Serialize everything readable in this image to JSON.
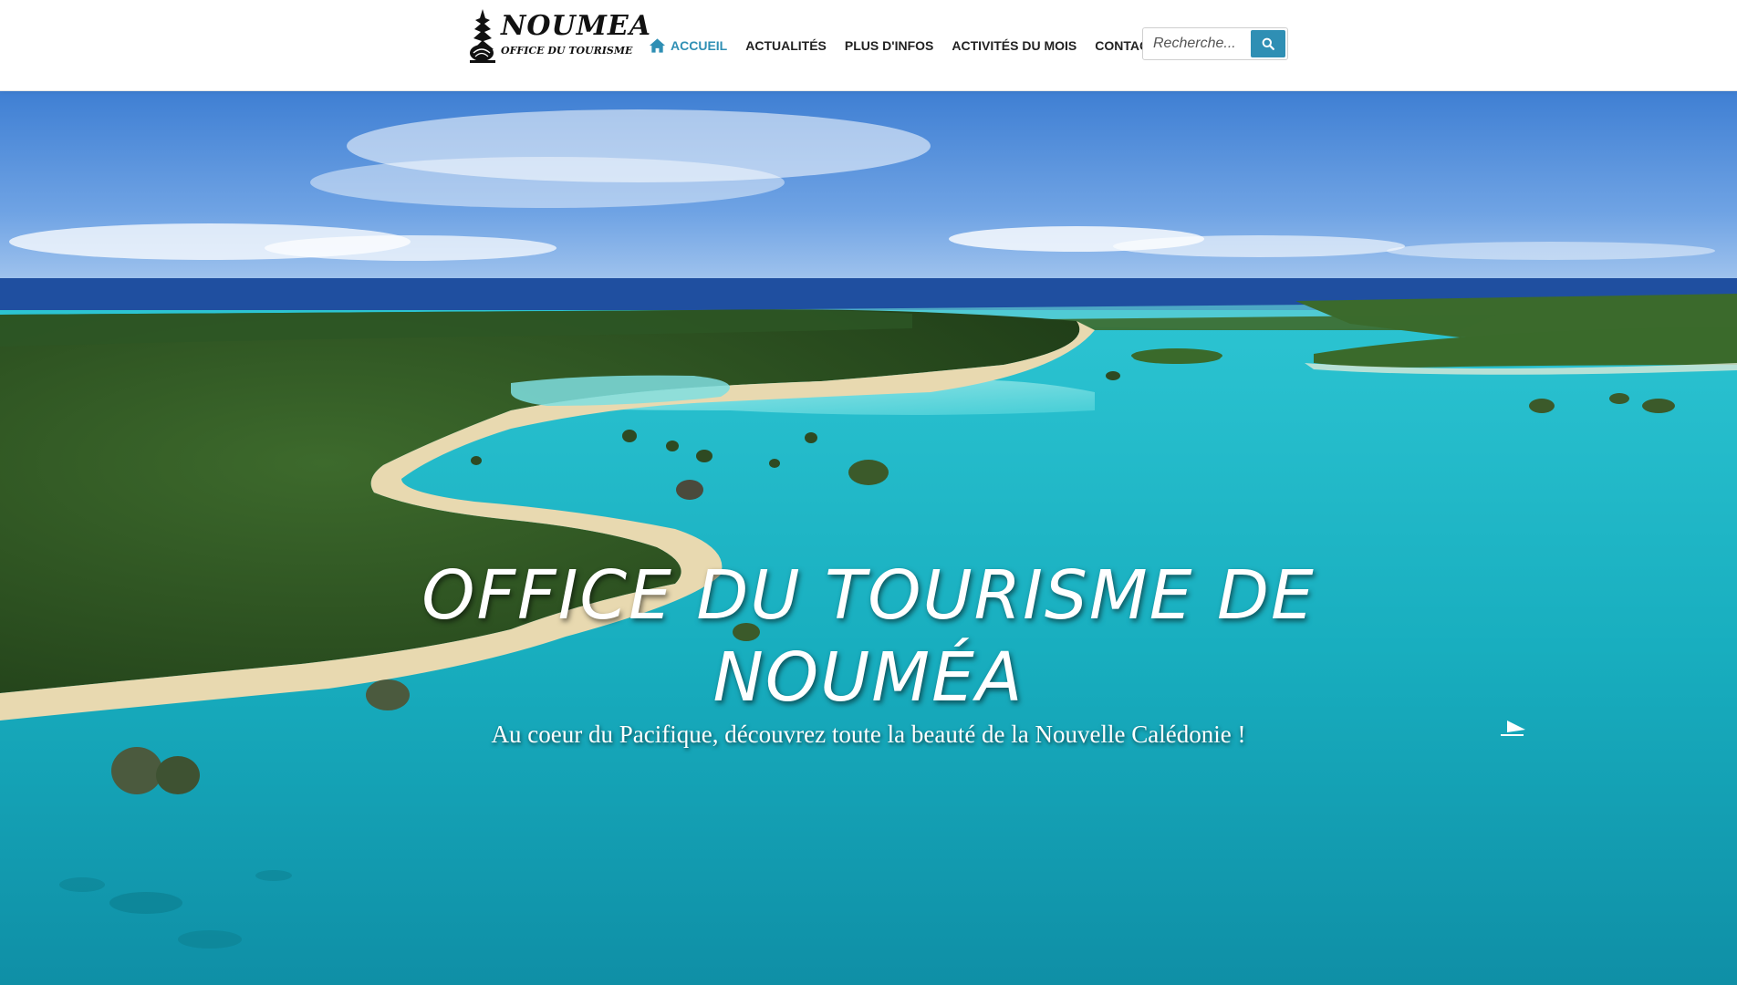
{
  "logo": {
    "title": "NOUMEA",
    "subtitle": "OFFICE DU TOURISME"
  },
  "nav": {
    "items": [
      {
        "label": "ACCUEIL",
        "active": true,
        "icon": "home-icon"
      },
      {
        "label": "ACTUALITÉS",
        "active": false
      },
      {
        "label": "PLUS D'INFOS",
        "active": false
      },
      {
        "label": "ACTIVITÉS DU MOIS",
        "active": false
      },
      {
        "label": "CONTACT",
        "active": false
      }
    ]
  },
  "search": {
    "placeholder": "Recherche...",
    "icon": "search-icon"
  },
  "hero": {
    "title": "OFFICE DU TOURISME DE NOUMÉA",
    "subtitle": "Au coeur du Pacifique, découvrez toute la beauté de la Nouvelle Calédonie !"
  },
  "colors": {
    "accent": "#2f8fb4",
    "nav_text": "#222222",
    "lagoon": "#1fb5c4",
    "ocean": "#1e4f9e",
    "forest": "#2f5a24",
    "sand": "#e6d7ae"
  }
}
